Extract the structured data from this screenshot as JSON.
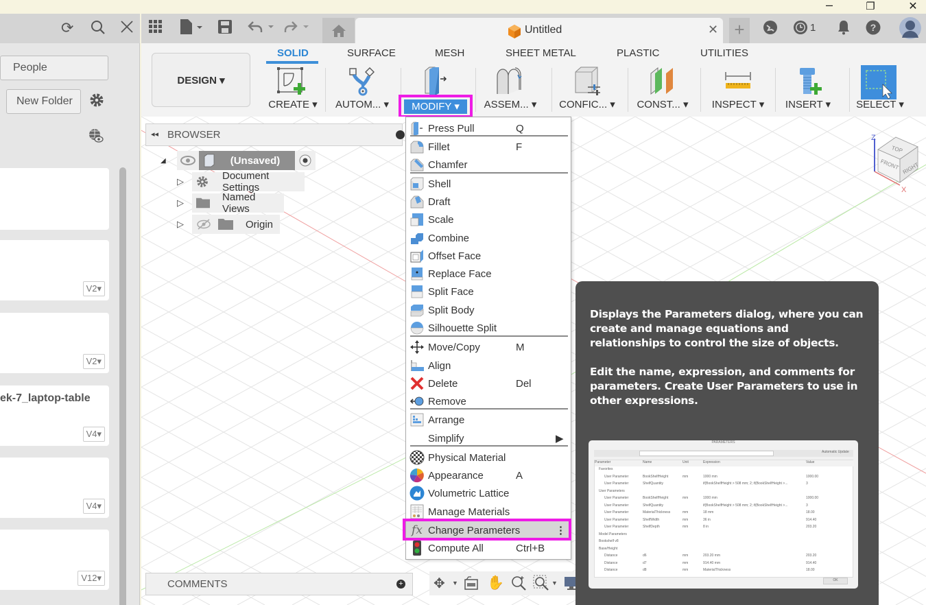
{
  "window": {
    "minimize": "–",
    "restore": "❐",
    "close": "✕"
  },
  "left_panel": {
    "people_label": "People",
    "new_folder_label": "New Folder",
    "cards": [
      {
        "title": "",
        "version": "V2▾"
      },
      {
        "title": "",
        "version": "V2▾"
      },
      {
        "title": "ek-7_laptop-table",
        "version": "V4▾"
      },
      {
        "title": "",
        "version": "V4▾"
      },
      {
        "title": "",
        "version": "V12▾"
      }
    ]
  },
  "appbar": {
    "doc_title": "Untitled",
    "close_tab": "✕",
    "job_count": "1"
  },
  "ribbon": {
    "workspace": "DESIGN ▾",
    "tabs": [
      "SOLID",
      "SURFACE",
      "MESH",
      "SHEET METAL",
      "PLASTIC",
      "UTILITIES"
    ],
    "active_tab": "SOLID",
    "groups": [
      "CREATE ▾",
      "AUTOM... ▾",
      "MODIFY ▾",
      "ASSEM... ▾",
      "CONFIC... ▾",
      "CONST... ▾",
      "INSPECT ▾",
      "INSERT ▾",
      "SELECT ▾"
    ]
  },
  "browser": {
    "title": "BROWSER",
    "root": "(Unsaved)",
    "items": [
      "Document Settings",
      "Named Views",
      "Origin"
    ]
  },
  "comments": {
    "title": "COMMENTS"
  },
  "modify_menu": {
    "items": [
      {
        "label": "Press Pull",
        "shortcut": "Q",
        "icon": "press-pull-icon"
      },
      {
        "label": "Fillet",
        "shortcut": "F",
        "icon": "fillet-icon"
      },
      {
        "label": "Chamfer",
        "shortcut": "",
        "icon": "chamfer-icon"
      },
      {
        "label": "Shell",
        "shortcut": "",
        "icon": "shell-icon"
      },
      {
        "label": "Draft",
        "shortcut": "",
        "icon": "draft-icon"
      },
      {
        "label": "Scale",
        "shortcut": "",
        "icon": "scale-icon"
      },
      {
        "label": "Combine",
        "shortcut": "",
        "icon": "combine-icon"
      },
      {
        "label": "Offset Face",
        "shortcut": "",
        "icon": "offset-face-icon"
      },
      {
        "label": "Replace Face",
        "shortcut": "",
        "icon": "replace-face-icon"
      },
      {
        "label": "Split Face",
        "shortcut": "",
        "icon": "split-face-icon"
      },
      {
        "label": "Split Body",
        "shortcut": "",
        "icon": "split-body-icon"
      },
      {
        "label": "Silhouette Split",
        "shortcut": "",
        "icon": "silhouette-split-icon"
      },
      {
        "label": "Move/Copy",
        "shortcut": "M",
        "icon": "move-icon"
      },
      {
        "label": "Align",
        "shortcut": "",
        "icon": "align-icon"
      },
      {
        "label": "Delete",
        "shortcut": "Del",
        "icon": "delete-icon"
      },
      {
        "label": "Remove",
        "shortcut": "",
        "icon": "remove-icon"
      },
      {
        "label": "Arrange",
        "shortcut": "",
        "icon": "arrange-icon"
      },
      {
        "label": "Simplify",
        "shortcut": "▶",
        "icon": ""
      },
      {
        "label": "Physical Material",
        "shortcut": "",
        "icon": "physical-material-icon"
      },
      {
        "label": "Appearance",
        "shortcut": "A",
        "icon": "appearance-icon"
      },
      {
        "label": "Volumetric Lattice",
        "shortcut": "",
        "icon": "volumetric-lattice-icon"
      },
      {
        "label": "Manage Materials",
        "shortcut": "",
        "icon": "manage-materials-icon"
      },
      {
        "label": "Change Parameters",
        "shortcut": "⋮",
        "icon": "fx-icon"
      },
      {
        "label": "Compute All",
        "shortcut": "Ctrl+B",
        "icon": "compute-all-icon"
      }
    ]
  },
  "tooltip": {
    "para1": "Displays the Parameters dialog, where you can create and manage equations and relationships to control the size of objects.",
    "para2": "Edit the name, expression, and comments for parameters. Create User Parameters to use in other expressions.",
    "preview": {
      "title": "PARAMETERS",
      "columns": [
        "Parameter",
        "Name",
        "Unit",
        "Expression",
        "Value",
        "Comments"
      ],
      "rows": [
        [
          "Favorites",
          "",
          "",
          "",
          ""
        ],
        [
          "User Parameter",
          "BookShelfHeight",
          "mm",
          "1000 mm",
          "1000.00"
        ],
        [
          "User Parameter",
          "ShelfQuantity",
          "",
          "if(BookShelfHeight > 508 mm; 2; if(BookShelfHeight >...",
          "3"
        ],
        [
          "User Parameters",
          "",
          "",
          "",
          ""
        ],
        [
          "User Parameter",
          "BookShelfHeight",
          "mm",
          "1000 mm",
          "1000.00"
        ],
        [
          "User Parameter",
          "ShelfQuantity",
          "",
          "if(BookShelfHeight > 508 mm; 2; if(BookShelfHeight >...",
          "3"
        ],
        [
          "User Parameter",
          "MaterialThickness",
          "mm",
          "18 mm",
          "18.00"
        ],
        [
          "User Parameter",
          "ShelfWidth",
          "mm",
          "36 in",
          "914.40"
        ],
        [
          "User Parameter",
          "ShelfDepth",
          "mm",
          "8 in",
          "203.20"
        ],
        [
          "Model Parameters",
          "",
          "",
          "",
          ""
        ],
        [
          "Bookshelf v8",
          "",
          "",
          "",
          ""
        ],
        [
          "Base/Height",
          "",
          "",
          "",
          ""
        ],
        [
          "Distance",
          "d6",
          "mm",
          "203.20 mm",
          "203.20"
        ],
        [
          "Distance",
          "d7",
          "mm",
          "914.40 mm",
          "914.40"
        ],
        [
          "Distance",
          "d8",
          "mm",
          "MaterialThickness",
          "18.00"
        ]
      ],
      "auto_update": "Automatic Update",
      "ok": "OK"
    }
  },
  "viewcube": {
    "top": "TOP",
    "front": "FRONT",
    "right": "RIGHT",
    "z": "Z",
    "x": "X"
  },
  "colors": {
    "accent": "#3e8edc",
    "highlight": "#ee1ce6",
    "tooltip_bg": "#4f4f4f"
  }
}
